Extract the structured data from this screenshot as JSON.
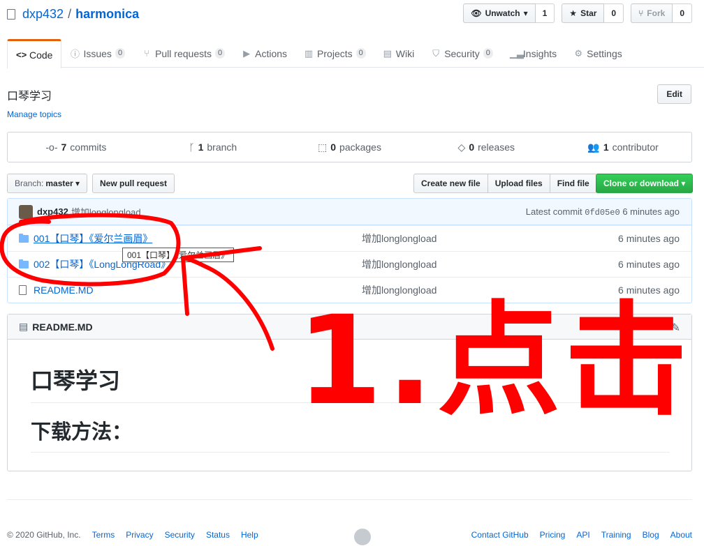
{
  "repo": {
    "owner": "dxp432",
    "separator": "/",
    "name": "harmonica"
  },
  "actions": {
    "watch": {
      "label": "Unwatch",
      "count": "1"
    },
    "star": {
      "label": "Star",
      "count": "0"
    },
    "fork": {
      "label": "Fork",
      "count": "0"
    }
  },
  "tabs": [
    {
      "label": "Code",
      "icon": "code-icon",
      "counter": ""
    },
    {
      "label": "Issues",
      "icon": "issue-icon",
      "counter": "0"
    },
    {
      "label": "Pull requests",
      "icon": "pull-request-icon",
      "counter": "0"
    },
    {
      "label": "Actions",
      "icon": "play-icon",
      "counter": ""
    },
    {
      "label": "Projects",
      "icon": "project-icon",
      "counter": "0"
    },
    {
      "label": "Wiki",
      "icon": "book-icon",
      "counter": ""
    },
    {
      "label": "Security",
      "icon": "shield-icon",
      "counter": "0"
    },
    {
      "label": "Insights",
      "icon": "graph-icon",
      "counter": ""
    },
    {
      "label": "Settings",
      "icon": "gear-icon",
      "counter": ""
    }
  ],
  "description": "口琴学习",
  "manage_topics": "Manage topics",
  "edit_label": "Edit",
  "summary": [
    {
      "num": "7",
      "label": "commits",
      "icon": "history-icon"
    },
    {
      "num": "1",
      "label": "branch",
      "icon": "branch-icon"
    },
    {
      "num": "0",
      "label": "packages",
      "icon": "package-icon"
    },
    {
      "num": "0",
      "label": "releases",
      "icon": "tag-icon"
    },
    {
      "num": "1",
      "label": "contributor",
      "icon": "people-icon"
    }
  ],
  "toolbar": {
    "branch_prefix": "Branch:",
    "branch_name": "master",
    "new_pr": "New pull request",
    "create_file": "Create new file",
    "upload_files": "Upload files",
    "find_file": "Find file",
    "clone": "Clone or download"
  },
  "commit": {
    "author": "dxp432",
    "message": "增加longlongload",
    "latest_label": "Latest commit",
    "sha": "0fd05e0",
    "age": "6 minutes ago"
  },
  "files": [
    {
      "name": "001【口琴】《爱尔兰画眉》",
      "type": "folder",
      "message": "增加longlongload",
      "age": "6 minutes ago"
    },
    {
      "name": "002【口琴】《LongLongRoad》",
      "type": "folder",
      "message": "增加longlongload",
      "age": "6 minutes ago"
    },
    {
      "name": "README.MD",
      "type": "file",
      "message": "增加longlongload",
      "age": "6 minutes ago"
    }
  ],
  "tooltip": "001【口琴】《爱尔兰画眉》",
  "readme": {
    "header": "README.MD",
    "h1": "口琴学习",
    "h2": "下载方法："
  },
  "annotation": {
    "text": "1.点击",
    "color": "#ff0000"
  },
  "footer": {
    "copyright": "© 2020 GitHub, Inc.",
    "left_links": [
      "Terms",
      "Privacy",
      "Security",
      "Status",
      "Help"
    ],
    "right_links": [
      "Contact GitHub",
      "Pricing",
      "API",
      "Training",
      "Blog",
      "About"
    ]
  },
  "colors": {
    "link": "#0366d6",
    "tab_accent": "#e36209",
    "clone_green": "#28a745",
    "commit_bar": "#f1f8ff"
  }
}
